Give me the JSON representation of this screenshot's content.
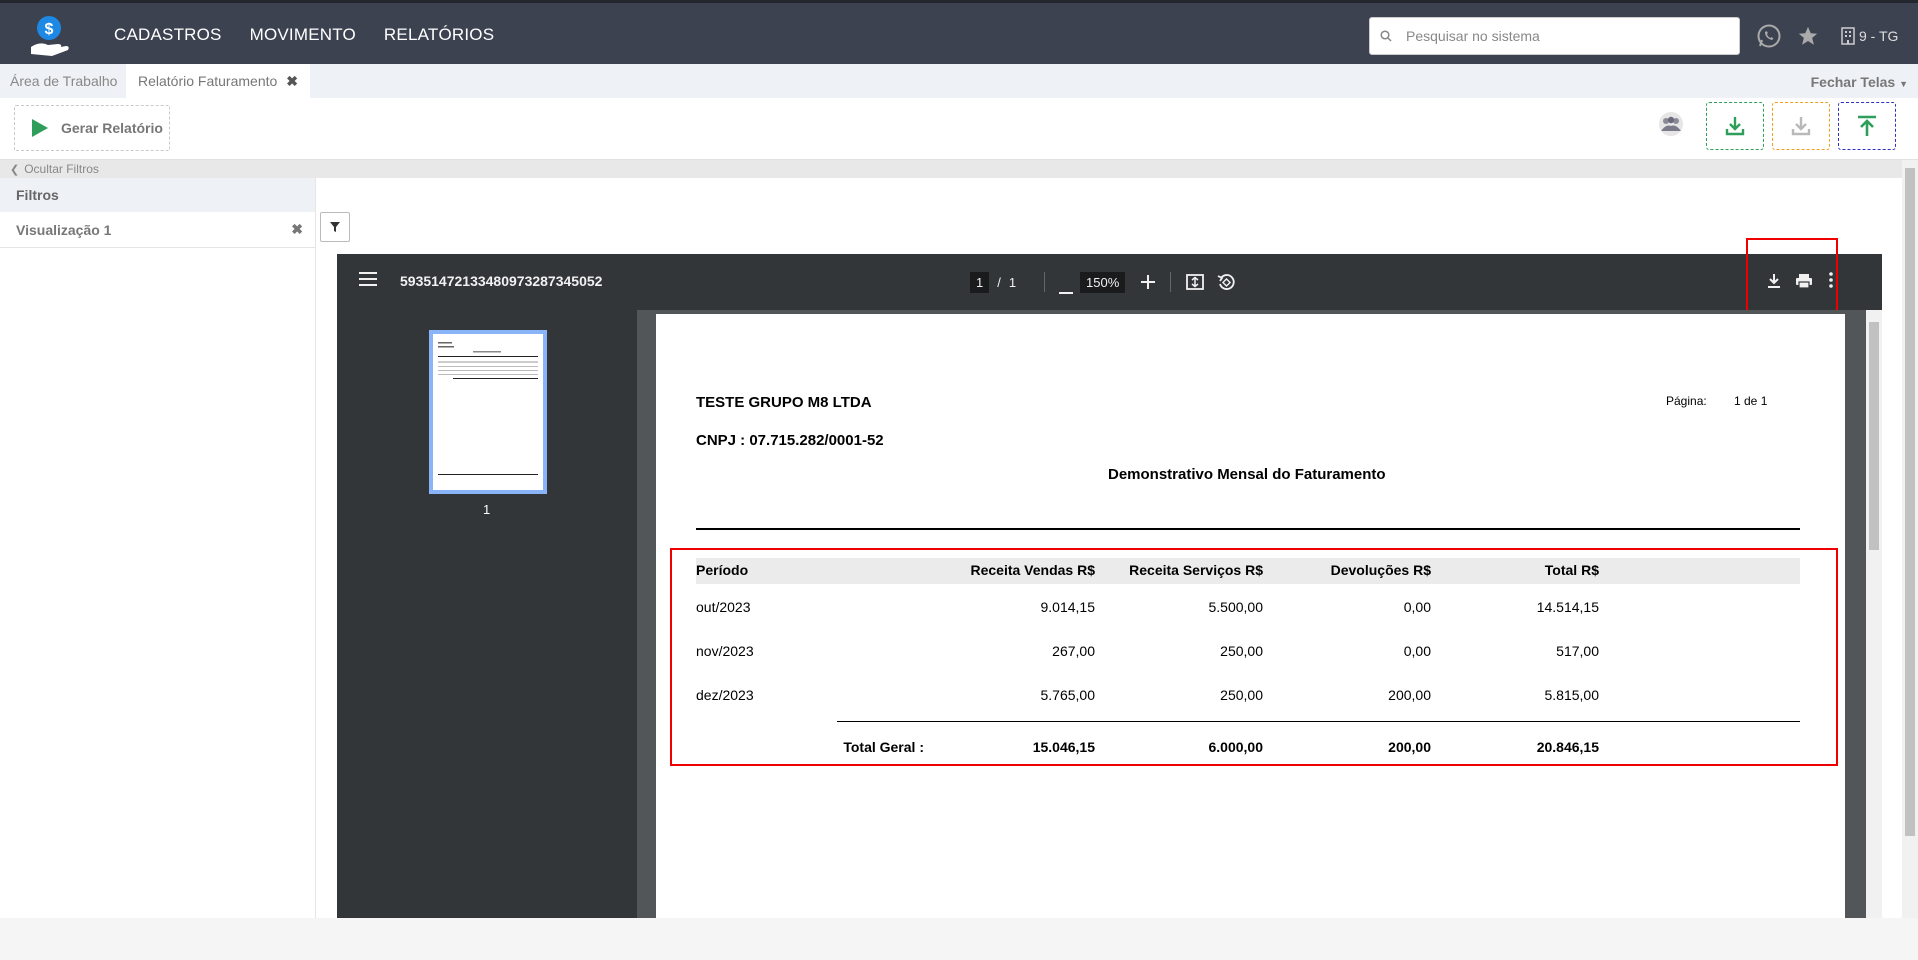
{
  "nav": {
    "items": [
      "CADASTROS",
      "MOVIMENTO",
      "RELATÓRIOS"
    ],
    "search_placeholder": "Pesquisar no sistema",
    "user": "9 - TG"
  },
  "tabs": {
    "home": "Área de Trabalho",
    "active": "Relatório Faturamento",
    "close_all": "Fechar Telas"
  },
  "toolbar": {
    "generate_label": "Gerar Relatório"
  },
  "filters": {
    "hide_label": "Ocultar Filtros",
    "header": "Filtros",
    "view_label": "Visualização 1"
  },
  "pdf": {
    "filename": "5935147213348097328734505​2",
    "page_current": "1",
    "page_sep": "/",
    "page_total": "1",
    "zoom": "150%",
    "thumb_label": "1"
  },
  "report": {
    "company": "TESTE GRUPO M8 LTDA",
    "cnpj": "CNPJ : 07.715.282/0001-52",
    "page_label": "Página:",
    "page_value": "1 de 1",
    "title": "Demonstrativo Mensal do Faturamento",
    "columns": [
      "Período",
      "Receita Vendas R$",
      "Receita Serviços R$",
      "Devoluções R$",
      "Total R$"
    ],
    "rows": [
      [
        "out/2023",
        "9.014,15",
        "5.500,00",
        "0,00",
        "14.514,15"
      ],
      [
        "nov/2023",
        "267,00",
        "250,00",
        "0,00",
        "517,00"
      ],
      [
        "dez/2023",
        "5.765,00",
        "250,00",
        "200,00",
        "5.815,00"
      ]
    ],
    "total_label": "Total Geral :",
    "totals": [
      "15.046,15",
      "6.000,00",
      "200,00",
      "20.846,15"
    ]
  },
  "colors": {
    "topbar": "#3c4250",
    "download_green": "#2e9e5a",
    "download_orange": "#f0a020",
    "upload_blue": "#3030c0",
    "highlight_red": "#e00000"
  }
}
